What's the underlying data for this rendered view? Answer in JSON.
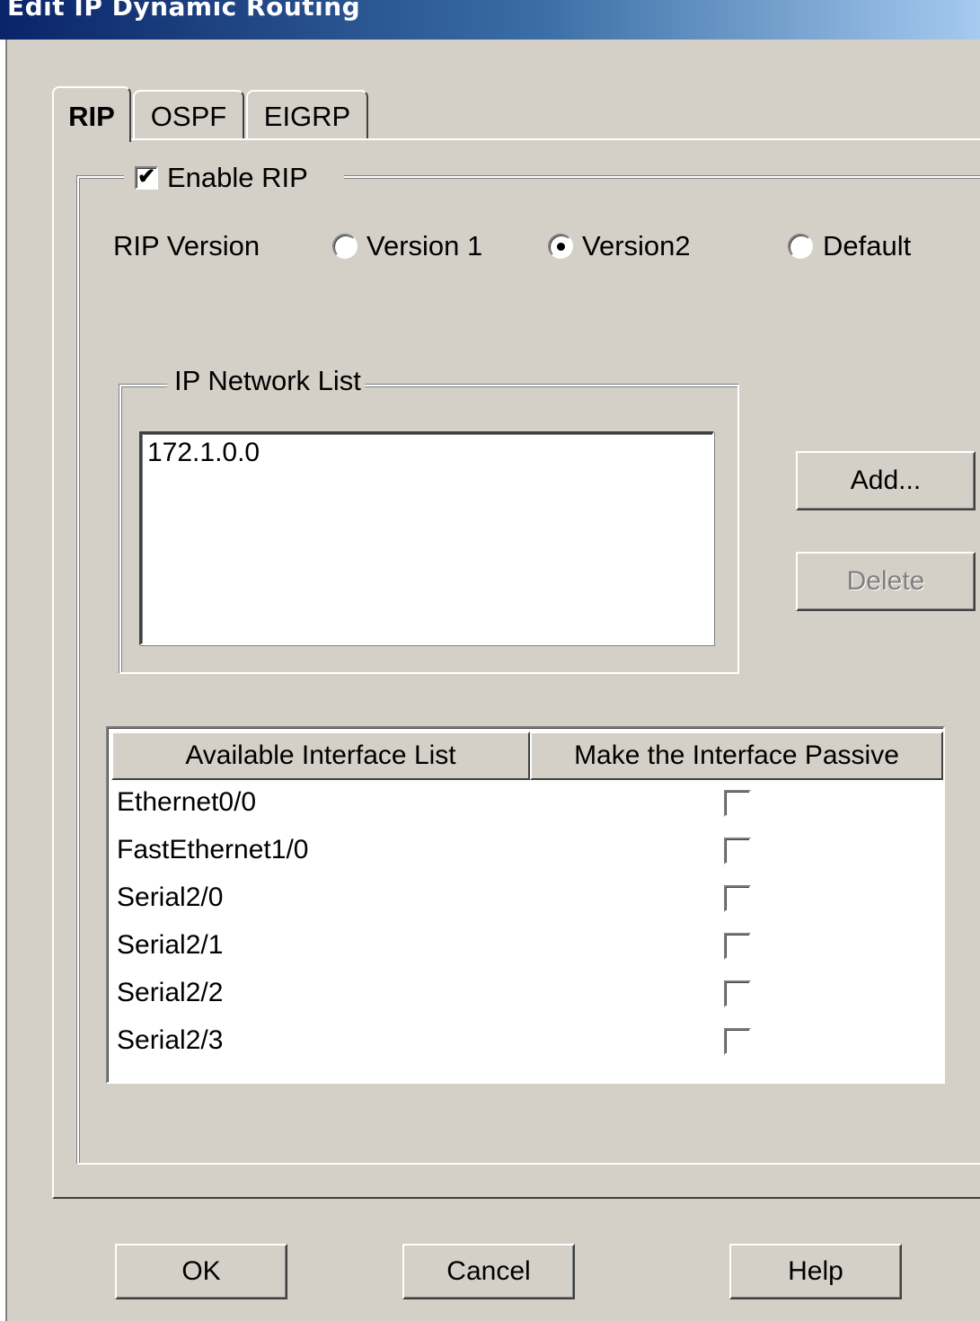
{
  "window": {
    "title": "Edit IP Dynamic Routing"
  },
  "tabs": [
    {
      "label": "RIP",
      "active": true
    },
    {
      "label": "OSPF",
      "active": false
    },
    {
      "label": "EIGRP",
      "active": false
    }
  ],
  "rip": {
    "enable_label": "Enable RIP",
    "enabled": true,
    "version_label": "RIP Version",
    "versions": [
      {
        "label": "Version 1",
        "selected": false
      },
      {
        "label": "Version2",
        "selected": true
      },
      {
        "label": "Default",
        "selected": false
      }
    ]
  },
  "network_list": {
    "group_label": "IP Network List",
    "items": [
      "172.1.0.0"
    ],
    "add_label": "Add...",
    "delete_label": "Delete",
    "delete_enabled": false
  },
  "interfaces": {
    "columns": [
      "Available Interface List",
      "Make the Interface Passive"
    ],
    "rows": [
      {
        "name": "Ethernet0/0",
        "passive": false
      },
      {
        "name": "FastEthernet1/0",
        "passive": false
      },
      {
        "name": "Serial2/0",
        "passive": false
      },
      {
        "name": "Serial2/1",
        "passive": false
      },
      {
        "name": "Serial2/2",
        "passive": false
      },
      {
        "name": "Serial2/3",
        "passive": false
      }
    ]
  },
  "footer": {
    "ok_label": "OK",
    "cancel_label": "Cancel",
    "help_label": "Help"
  },
  "icons": {
    "checkbox_checked": "checkmark-icon"
  },
  "colors": {
    "dialog_bg": "#d4d0c8",
    "title_start": "#0a246a",
    "title_end": "#a6caf0",
    "disabled_text": "#808080"
  }
}
